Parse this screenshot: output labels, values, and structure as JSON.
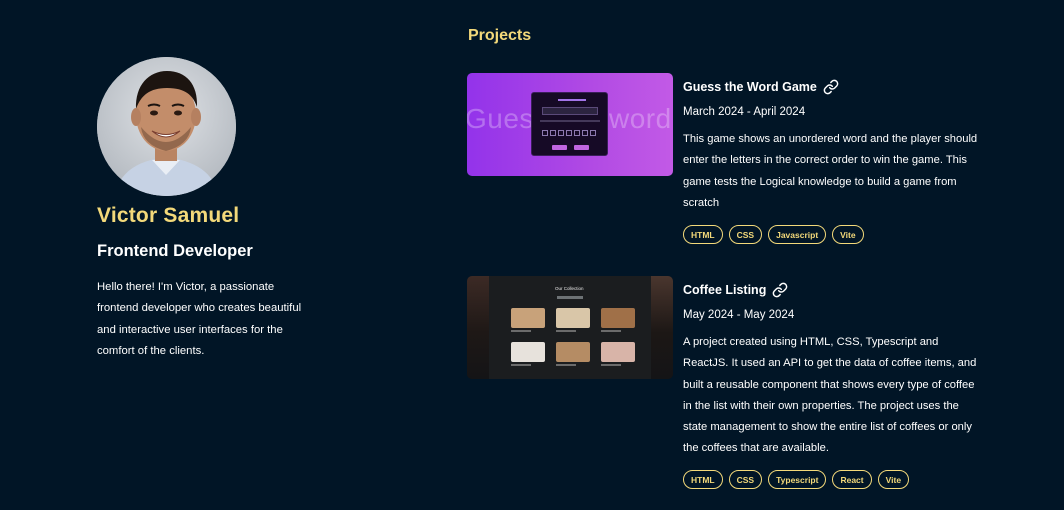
{
  "profile": {
    "name": "Victor Samuel",
    "role": "Frontend Developer",
    "bio": "Hello there! I'm Victor, a passionate frontend developer who creates beautiful and interactive user interfaces for the comfort of the clients."
  },
  "projects_section": {
    "title": "Projects",
    "items": [
      {
        "title": "Guess the Word Game",
        "dates": "March 2024 - April 2024",
        "description": "This game shows an unordered word and the player should enter the letters in the correct order to win the game. This game tests the Logical knowledge to build a game from scratch",
        "link_icon": "link-icon",
        "thumbnail_text_left": "Gues",
        "thumbnail_text_right": "word",
        "tags": [
          "HTML",
          "CSS",
          "Javascript",
          "Vite"
        ]
      },
      {
        "title": "Coffee Listing",
        "dates": "May 2024 - May 2024",
        "description": "A project created using HTML, CSS, Typescript and ReactJS. It used an API to get the data of coffee items, and built a reusable component that shows every type of coffee in the list with their own properties. The project uses the state management to show the entire list of coffees or only the coffees that are available.",
        "link_icon": "link-icon",
        "thumbnail_title": "Our Collection",
        "tags": [
          "HTML",
          "CSS",
          "Typescript",
          "React",
          "Vite"
        ]
      }
    ]
  },
  "colors": {
    "background": "#011526",
    "accent": "#f3d97a",
    "text": "#ffffff"
  }
}
